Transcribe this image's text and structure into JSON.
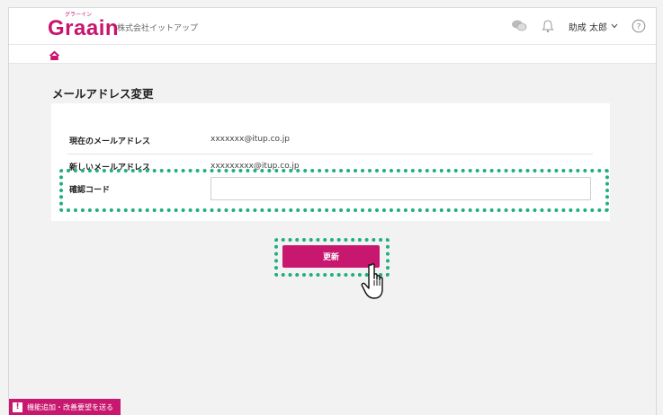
{
  "header": {
    "logo": "Graain",
    "logo_ruby": "グラーイン",
    "company": "株式会社イットアップ",
    "user_name": "助成 太郎",
    "icons": [
      "chat-icon",
      "bell-icon",
      "chevron-down-icon",
      "help-icon"
    ]
  },
  "nav": {
    "home_icon": "home-icon"
  },
  "page": {
    "title": "メールアドレス変更"
  },
  "form": {
    "current_label": "現在のメールアドレス",
    "current_value": "xxxxxxx@itup.co.jp",
    "new_label": "新しいメールアドレス",
    "new_value": "xxxxxxxxx@itup.co.jp",
    "code_label": "確認コード",
    "code_value": "",
    "update_label": "更新"
  },
  "footer": {
    "feedback_label": "機能追加・改善要望を送る"
  },
  "colors": {
    "brand": "#c8176f",
    "highlight": "#1fae84"
  }
}
